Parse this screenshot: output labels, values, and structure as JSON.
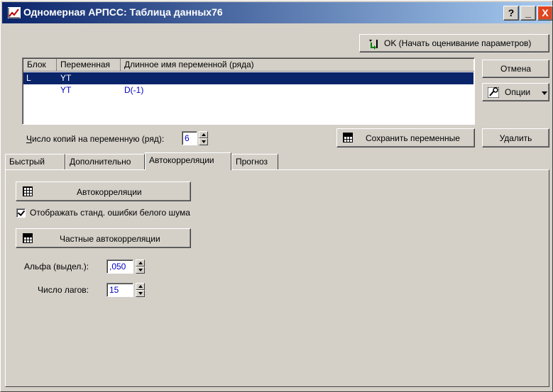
{
  "window": {
    "title": "Одномерная АРПСС: Таблица данных76",
    "help_label": "?",
    "minimize_label": "_",
    "close_label": "X"
  },
  "buttons": {
    "ok_label": "OK (Начать оценивание параметров)",
    "cancel_label": "Отмена",
    "options_label": "Опции",
    "save_vars_label": "Сохранить переменные",
    "delete_label": "Удалить"
  },
  "list": {
    "headers": [
      "Блок",
      "Переменная",
      "Длинное имя переменной (ряда)"
    ],
    "rows": [
      {
        "block": "L",
        "variable": "YT",
        "longname": "",
        "selected": true
      },
      {
        "block": "",
        "variable": "YT",
        "longname": "D(-1)",
        "selected": false
      }
    ]
  },
  "copies": {
    "label_prefix": "Ч",
    "label_rest": "исло копий на переменную (ряд):",
    "value": "6"
  },
  "tabs": [
    {
      "label": "Быстрый",
      "active": false
    },
    {
      "label": "Дополнительно",
      "active": false
    },
    {
      "label": "Автокорреляции",
      "active": true
    },
    {
      "label": "Прогноз",
      "active": false
    }
  ],
  "panel": {
    "autocorr_button": "Автокорреляции",
    "white_noise_checkbox": {
      "label": "Отображать станд. ошибки белого шума",
      "checked": true
    },
    "partial_autocorr_button": "Частные автокорреляции",
    "alpha": {
      "label": "Альфа (выдел.):",
      "value": ",050"
    },
    "lags": {
      "label": "Число лагов:",
      "value": "15"
    }
  }
}
